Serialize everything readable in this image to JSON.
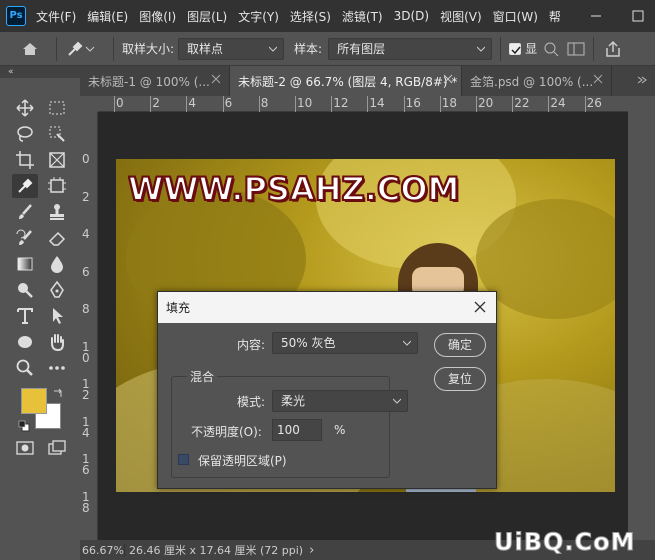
{
  "app": {
    "logo": "Ps"
  },
  "menu": [
    "文件(F)",
    "编辑(E)",
    "图像(I)",
    "图层(L)",
    "文字(Y)",
    "选择(S)",
    "滤镜(T)",
    "3D(D)",
    "视图(V)",
    "窗口(W)",
    "帮"
  ],
  "options": {
    "sample_size_label": "取样大小:",
    "sample_size_value": "取样点",
    "sample_label": "样本:",
    "sample_value": "所有图层",
    "show_label": "显"
  },
  "toolbar": {
    "collapse": "«",
    "foreground_color": "#e7c13a",
    "background_color": "#ffffff"
  },
  "tabs": [
    {
      "label": "未标题-1 @ 100% (..."
    },
    {
      "label": "未标题-2 @ 66.7% (图层 4, RGB/8#) *"
    },
    {
      "label": "金箔.psd @ 100% (..."
    }
  ],
  "ruler_h": [
    "0",
    "2",
    "4",
    "6",
    "8",
    "10",
    "12",
    "14",
    "16",
    "18",
    "20",
    "22",
    "24",
    "26"
  ],
  "ruler_v": [
    "0",
    "2",
    "4",
    "6",
    "8",
    "1 0",
    "1 2",
    "1 4",
    "1 6",
    "1 8"
  ],
  "canvas": {
    "watermark": "WWW.PSAHZ.COM"
  },
  "dialog": {
    "title": "填充",
    "content_label": "内容:",
    "content_value": "50% 灰色",
    "ok_label": "确定",
    "reset_label": "复位",
    "blend_group": "混合",
    "mode_label": "模式:",
    "mode_value": "柔光",
    "opacity_label": "不透明度(O):",
    "opacity_value": "100",
    "opacity_unit": "%",
    "preserve_label": "保留透明区域(P)"
  },
  "status": {
    "zoom": "66.67%",
    "dims": "26.46 厘米 x 17.64 厘米 (72 ppi)",
    "arrow": "›"
  },
  "brand": "UiBQ.CoM"
}
